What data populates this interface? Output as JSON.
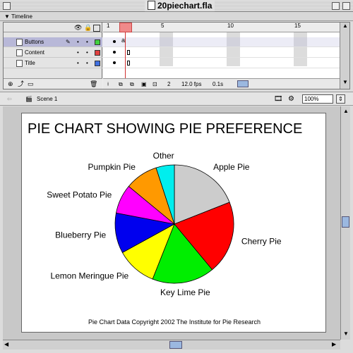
{
  "window": {
    "title": "20piechart.fla"
  },
  "timeline": {
    "panel_label": "Timeline",
    "layers": [
      {
        "name": "Buttons",
        "color": "#40d040",
        "selected": true
      },
      {
        "name": "Content",
        "color": "#e04040",
        "selected": false
      },
      {
        "name": "Title",
        "color": "#4070e0",
        "selected": false
      }
    ],
    "ruler_numbers": [
      "1",
      "5",
      "10",
      "15"
    ],
    "current_frame": "2",
    "frame_rate": "12.0 fps",
    "elapsed": "0.1s"
  },
  "editbar": {
    "scene": "Scene 1",
    "zoom": "100%"
  },
  "chart_data": {
    "type": "pie",
    "title": "PIE  CHART SHOWING PIE PREFERENCE",
    "footnote": "Pie Chart Data Copyright 2002 The Institute for Pie Research",
    "slices": [
      {
        "label": "Apple Pie",
        "value": 19,
        "color": "#cccccc"
      },
      {
        "label": "Cherry Pie",
        "value": 20,
        "color": "#ff0000"
      },
      {
        "label": "Key Lime Pie",
        "value": 17,
        "color": "#00ee00"
      },
      {
        "label": "Lemon Meringue Pie",
        "value": 11,
        "color": "#ffff00"
      },
      {
        "label": "Blueberry Pie",
        "value": 11,
        "color": "#0000ee"
      },
      {
        "label": "Sweet Potato Pie",
        "value": 8,
        "color": "#ff00ff"
      },
      {
        "label": "Pumpkin Pie",
        "value": 9,
        "color": "#ff9900"
      },
      {
        "label": "Other",
        "value": 5,
        "color": "#00eeee"
      }
    ]
  }
}
